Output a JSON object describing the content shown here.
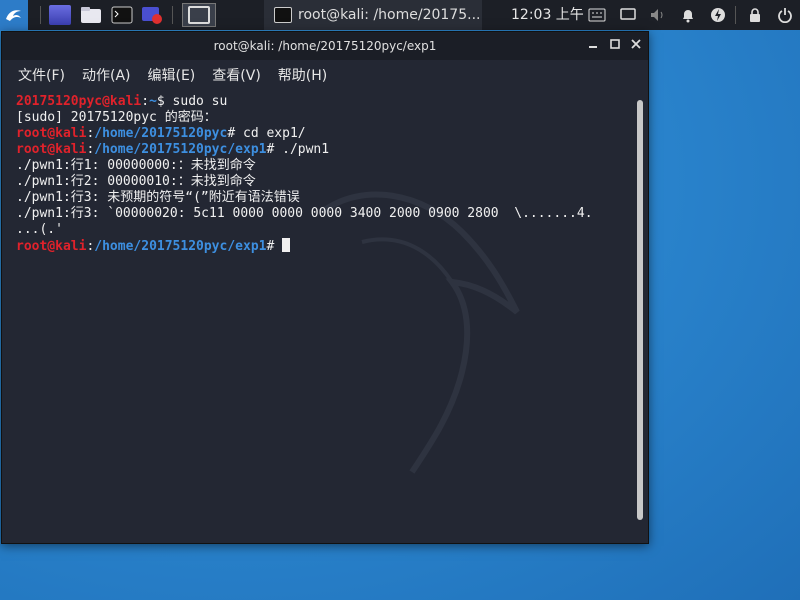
{
  "panel": {
    "task_title": "root@kali: /home/20175...",
    "clock": "12:03 上午",
    "icons": [
      "kali-menu-icon",
      "file-manager-icon",
      "folder-icon",
      "terminal-icon",
      "screen-recorder-icon"
    ]
  },
  "window": {
    "title": "root@kali: /home/20175120pyc/exp1",
    "controls": [
      "minimize",
      "maximize",
      "close"
    ]
  },
  "menu": [
    "文件(F)",
    "动作(A)",
    "编辑(E)",
    "查看(V)",
    "帮助(H)"
  ],
  "terminal": {
    "lines": [
      {
        "parts": [
          {
            "t": "20175120pyc@kali",
            "c": "red"
          },
          {
            "t": ":",
            "c": ""
          },
          {
            "t": "~",
            "c": "blue"
          },
          {
            "t": "$ sudo su",
            "c": ""
          }
        ]
      },
      {
        "parts": [
          {
            "t": "[sudo] 20175120pyc 的密码：",
            "c": ""
          }
        ]
      },
      {
        "parts": [
          {
            "t": "root@kali",
            "c": "red"
          },
          {
            "t": ":",
            "c": ""
          },
          {
            "t": "/home/20175120pyc",
            "c": "blue"
          },
          {
            "t": "# cd exp1/",
            "c": ""
          }
        ]
      },
      {
        "parts": [
          {
            "t": "root@kali",
            "c": "red"
          },
          {
            "t": ":",
            "c": ""
          },
          {
            "t": "/home/20175120pyc/exp1",
            "c": "blue"
          },
          {
            "t": "# ./pwn1",
            "c": ""
          }
        ]
      },
      {
        "parts": [
          {
            "t": "./pwn1:行1: 00000000:：未找到命令",
            "c": ""
          }
        ]
      },
      {
        "parts": [
          {
            "t": "./pwn1:行2: 00000010:：未找到命令",
            "c": ""
          }
        ]
      },
      {
        "parts": [
          {
            "t": "./pwn1:行3: 未预期的符号“(”附近有语法错误",
            "c": ""
          }
        ]
      },
      {
        "parts": [
          {
            "t": "./pwn1:行3: `00000020: 5c11 0000 0000 0000 3400 2000 0900 2800  \\.......4.",
            "c": ""
          }
        ]
      },
      {
        "parts": [
          {
            "t": "...(.'",
            "c": ""
          }
        ]
      },
      {
        "parts": [
          {
            "t": "root@kali",
            "c": "red"
          },
          {
            "t": ":",
            "c": ""
          },
          {
            "t": "/home/20175120pyc/exp1",
            "c": "blue"
          },
          {
            "t": "# ",
            "c": ""
          }
        ],
        "cursor": true
      }
    ]
  },
  "colors": {
    "prompt_user": "#e0222b",
    "prompt_path": "#3d8fe0",
    "terminal_bg": "#232733",
    "panel_bg": "#1c1f26",
    "desktop_bg": "#2b86cf"
  }
}
